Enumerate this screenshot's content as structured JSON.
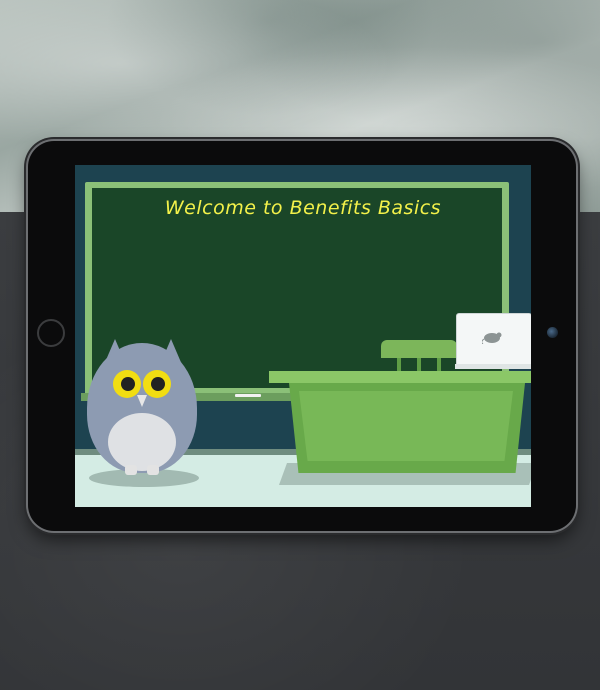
{
  "lesson": {
    "welcome_text": "Welcome to Benefits Basics"
  },
  "icons": {
    "laptop_logo": "mouse-icon"
  }
}
